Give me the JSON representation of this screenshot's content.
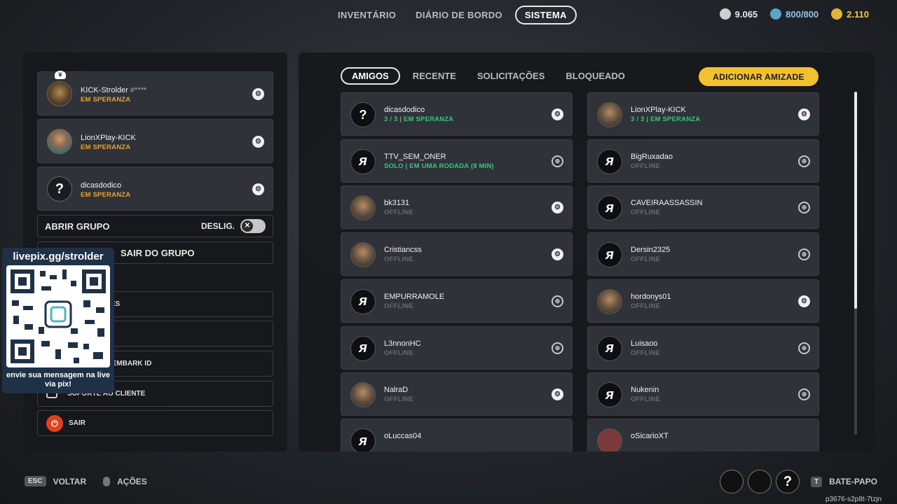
{
  "nav": {
    "tabs": [
      "INVENTÁRIO",
      "DIÁRIO DE BORDO",
      "SISTEMA"
    ],
    "active_tab": "SISTEMA"
  },
  "currencies": {
    "coins": "9.065",
    "capacity": "800/800",
    "gold": "2.110"
  },
  "party": {
    "members": [
      {
        "name": "KICK-Strolder",
        "tag": "#****",
        "status": "EM SPERANZA",
        "icon": "steam-icon"
      },
      {
        "name": "LionXPlay-KICK",
        "tag": "",
        "status": "EM SPERANZA",
        "icon": "steam-icon"
      },
      {
        "name": "dicasdodico",
        "tag": "",
        "status": "EM SPERANZA",
        "icon": "steam-icon"
      }
    ],
    "open_group_label": "ABRIR GRUPO",
    "open_group_toggle": "DESLIG.",
    "leave_group_label": "SAIR DO GRUPO",
    "menu": {
      "item1_partial": "ÕES",
      "item3_partial": "A EMBARK ID",
      "support": "SUPORTE AO CLIENTE",
      "exit": "SAIR"
    }
  },
  "qr_overlay": {
    "title": "livepix.gg/strolder",
    "caption": "envie sua mensagem na live via pix!"
  },
  "friends": {
    "tabs": [
      "AMIGOS",
      "RECENTE",
      "SOLICITAÇÕES",
      "BLOQUEADO"
    ],
    "active_tab": "AMIGOS",
    "add_button": "ADICIONAR AMIZADE",
    "list": [
      {
        "name": "dicasdodico",
        "status": "3 / 3 | EM SPERANZA",
        "online": true,
        "icon": "steam-icon",
        "avatar": "?"
      },
      {
        "name": "LionXPlay-KICK",
        "status": "3 / 3 | EM SPERANZA",
        "online": true,
        "icon": "steam-icon",
        "avatar": "photo"
      },
      {
        "name": "TTV_SEM_ONER",
        "status": "SOLO | EM UMA RODADA (8 MIN)",
        "online": true,
        "icon": "globe-icon",
        "avatar": "embark"
      },
      {
        "name": "BigRuxadao",
        "status": "OFFLINE",
        "online": false,
        "icon": "globe-icon",
        "avatar": "embark"
      },
      {
        "name": "bk3131",
        "status": "OFFLINE",
        "online": false,
        "icon": "steam-icon",
        "avatar": "photo"
      },
      {
        "name": "CAVEIRAASSASSIN",
        "status": "OFFLINE",
        "online": false,
        "icon": "globe-icon",
        "avatar": "embark"
      },
      {
        "name": "Cristiancss",
        "status": "OFFLINE",
        "online": false,
        "icon": "steam-icon",
        "avatar": "photo"
      },
      {
        "name": "Dersin2325",
        "status": "OFFLINE",
        "online": false,
        "icon": "globe-icon",
        "avatar": "embark"
      },
      {
        "name": "EMPURRAMOLE",
        "status": "OFFLINE",
        "online": false,
        "icon": "globe-icon",
        "avatar": "embark"
      },
      {
        "name": "hordonys01",
        "status": "OFFLINE",
        "online": false,
        "icon": "steam-icon",
        "avatar": "photo"
      },
      {
        "name": "L3nnonHC",
        "status": "OFFLINE",
        "online": false,
        "icon": "globe-icon",
        "avatar": "embark"
      },
      {
        "name": "Luisaoo",
        "status": "OFFLINE",
        "online": false,
        "icon": "globe-icon",
        "avatar": "embark"
      },
      {
        "name": "NalraD",
        "status": "OFFLINE",
        "online": false,
        "icon": "steam-icon",
        "avatar": "photo"
      },
      {
        "name": "Nukenin",
        "status": "OFFLINE",
        "online": false,
        "icon": "globe-icon",
        "avatar": "embark"
      }
    ],
    "partial_left": "oLuccas04",
    "partial_right": "oSicarioXT"
  },
  "bottom": {
    "esc_key": "ESC",
    "back_label": "VOLTAR",
    "actions_label": "AÇÕES",
    "chat_key": "T",
    "chat_label": "BATE-PAPO",
    "session_id": "p3676-s2p8t-7tzjn"
  }
}
